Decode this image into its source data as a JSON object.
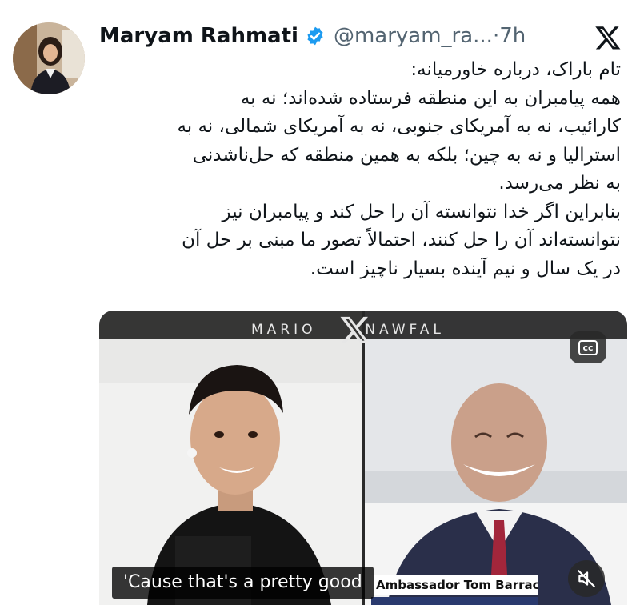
{
  "author": {
    "display_name": "Maryam Rahmati",
    "handle": "@maryam_ra...",
    "separator": "·",
    "time": "7h",
    "verified_color": "#1d9bf0"
  },
  "tweet": {
    "lines": [
      "تام باراک، درباره خاورمیانه:",
      "همه پیامبران به این منطقه فرستاده شده‌اند؛ نه به",
      "کارائیب، نه به آمریکای جنوبی، نه به آمریکای شمالی، نه به",
      "استرالیا و نه به چین؛ بلکه به همین منطقه که حل‌ناشدنی",
      "به نظر می‌رسد.",
      "بنابراین اگر خدا نتوانسته آن را حل کند و پیامبران نیز",
      "نتوانسته‌اند آن را حل کنند، احتمالاً تصور ما مبنی بر حل آن",
      "در یک سال و نیم آینده بسیار ناچیز است."
    ]
  },
  "media": {
    "brand_left": "MARIO",
    "brand_right": "NAWFAL",
    "cc_label": "cc",
    "caption": "'Cause that's a pretty good",
    "guest_name_tag": "Ambassador Tom Barrack",
    "icons": [
      "cc-icon",
      "mute-icon"
    ]
  },
  "icons": [
    "verified-badge-icon",
    "x-logo-icon"
  ]
}
